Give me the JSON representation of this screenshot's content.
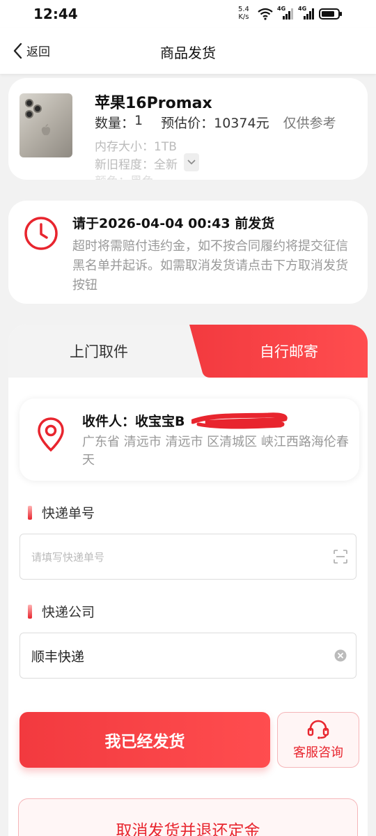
{
  "status_bar": {
    "time": "12:44",
    "net_speed_value": "5.4",
    "net_speed_unit": "K/s",
    "signal1_label": "4G",
    "signal2_label": "4G"
  },
  "nav": {
    "back_label": "返回",
    "title": "商品发货"
  },
  "product": {
    "name": "苹果16Promax",
    "quantity_label": "数量：",
    "quantity": "1",
    "price_label": "预估价：",
    "price": "10374元",
    "price_note": "仅供参考",
    "storage": "内存大小：1TB",
    "condition": "新旧程度：全新",
    "color_partial": "颜色：黑色"
  },
  "deadline": {
    "title": "请于2026-04-04 00:43 前发货",
    "description": "超时将需赔付违约金，如不按合同履约将提交征信黑名单并起诉。如需取消发货请点击下方取消发货按钮"
  },
  "tabs": {
    "pickup": "上门取件",
    "mail": "自行邮寄"
  },
  "address": {
    "recipient": "收件人：收宝宝B",
    "detail": "广东省 清远市 清远市 区清城区 峡江西路海伦春天"
  },
  "tracking": {
    "label": "快递单号",
    "placeholder": "请填写快递单号"
  },
  "courier": {
    "label": "快递公司",
    "value": "顺丰快递"
  },
  "actions": {
    "shipped": "我已经发货",
    "service": "客服咨询",
    "cancel": "取消发货并退还定金"
  },
  "colors": {
    "accent": "#e8252e",
    "accent_light": "#fff5f5"
  }
}
